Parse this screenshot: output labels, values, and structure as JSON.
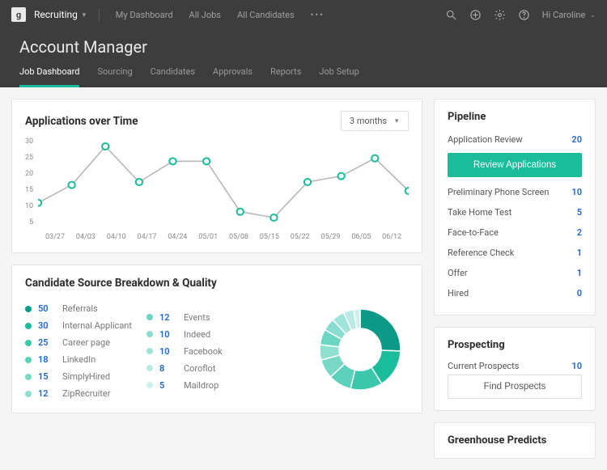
{
  "topbar": {
    "logo_letter": "g",
    "nav_label": "Recruiting",
    "items": [
      "My Dashboard",
      "All Jobs",
      "All Candidates"
    ],
    "user_greeting": "Hi Caroline"
  },
  "page": {
    "title": "Account Manager",
    "tabs": [
      "Job Dashboard",
      "Sourcing",
      "Candidates",
      "Approvals",
      "Reports",
      "Job Setup"
    ],
    "active_tab": 0
  },
  "applications_card": {
    "title": "Applications over Time",
    "range_label": "3 months"
  },
  "chart_data": {
    "type": "line",
    "title": "Applications over Time",
    "xlabel": "",
    "ylabel": "",
    "ylim": [
      0,
      30
    ],
    "yticks": [
      30,
      25,
      20,
      15,
      10,
      5
    ],
    "categories": [
      "03/27",
      "04/03",
      "04/10",
      "04/17",
      "04/24",
      "05/01",
      "05/08",
      "05/15",
      "05/22",
      "05/29",
      "06/05",
      "06/12"
    ],
    "values": [
      8,
      14,
      27,
      15,
      22,
      22,
      5,
      3,
      15,
      17,
      23,
      12
    ]
  },
  "sources_card": {
    "title": "Candidate Source Breakdown & Quality",
    "left": [
      {
        "count": 50,
        "name": "Referrals",
        "color": "#0a9a87"
      },
      {
        "count": 30,
        "name": "Internal Applicant",
        "color": "#1bbc9b"
      },
      {
        "count": 25,
        "name": "Career page",
        "color": "#3bc7ab"
      },
      {
        "count": 18,
        "name": "LinkedIn",
        "color": "#5bd0ba"
      },
      {
        "count": 15,
        "name": "SimplyHired",
        "color": "#76d8c5"
      },
      {
        "count": 12,
        "name": "ZipRecruiter",
        "color": "#8fe0d1"
      }
    ],
    "right": [
      {
        "count": 12,
        "name": "Events",
        "color": "#6cd6c4"
      },
      {
        "count": 10,
        "name": "Indeed",
        "color": "#88ddd0"
      },
      {
        "count": 10,
        "name": "Facebook",
        "color": "#9fe3d9"
      },
      {
        "count": 8,
        "name": "Coroflot",
        "color": "#b7eae2"
      },
      {
        "count": 5,
        "name": "Maildrop",
        "color": "#cef1eb"
      }
    ]
  },
  "pipeline": {
    "title": "Pipeline",
    "review_button": "Review Applications",
    "stages": [
      {
        "label": "Application Review",
        "value": 20
      },
      {
        "label": "Preliminary Phone Screen",
        "value": 10
      },
      {
        "label": "Take Home Test",
        "value": 5
      },
      {
        "label": "Face-to-Face",
        "value": 2
      },
      {
        "label": "Reference Check",
        "value": 1
      },
      {
        "label": "Offer",
        "value": 1
      },
      {
        "label": "Hired",
        "value": 0
      }
    ]
  },
  "prospecting": {
    "title": "Prospecting",
    "label": "Current Prospects",
    "value": 10,
    "button": "Find Prospects"
  },
  "predicts": {
    "title": "Greenhouse Predicts"
  }
}
